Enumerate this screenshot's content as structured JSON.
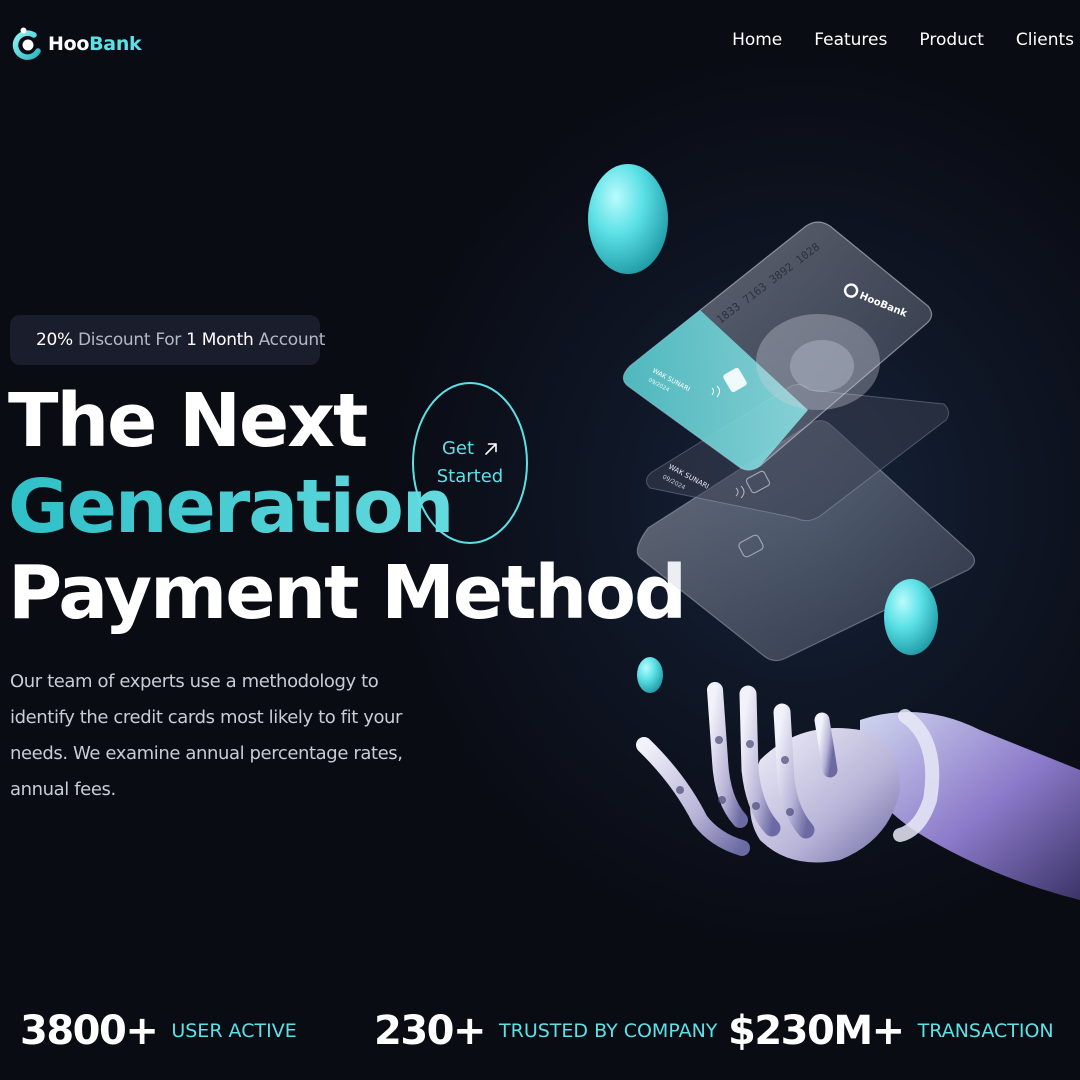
{
  "brand": {
    "name_part1": "Hoo",
    "name_part2": "Bank",
    "accent": "#5ce1e6"
  },
  "nav": {
    "items": [
      "Home",
      "Features",
      "Product",
      "Clients"
    ]
  },
  "badge": {
    "icon": "discount-icon",
    "highlight1": "20%",
    "text1": "Discount For",
    "highlight2": "1 Month",
    "text2": "Account"
  },
  "headline": {
    "line1": "The Next",
    "line2": "Generation",
    "line3": "Payment Method"
  },
  "cta": {
    "line1": "Get",
    "line2": "Started",
    "icon": "arrow-up-right-icon"
  },
  "description": "Our team of experts use a methodology to identify the credit cards most likely to fit your needs. We examine annual percentage rates, annual fees.",
  "cards": {
    "card_number": "1833 7163 3892 1028",
    "holder_top": "WAK SUNARI",
    "holder_bottom": "WAK SUNARI",
    "expiry": "09/2024",
    "brand_name": "HooBank"
  },
  "stats": [
    {
      "value": "3800+",
      "label": "USER ACTIVE"
    },
    {
      "value": "230+",
      "label": "TRUSTED BY COMPANY"
    },
    {
      "value": "$230M+",
      "label": "TRANSACTION"
    }
  ]
}
